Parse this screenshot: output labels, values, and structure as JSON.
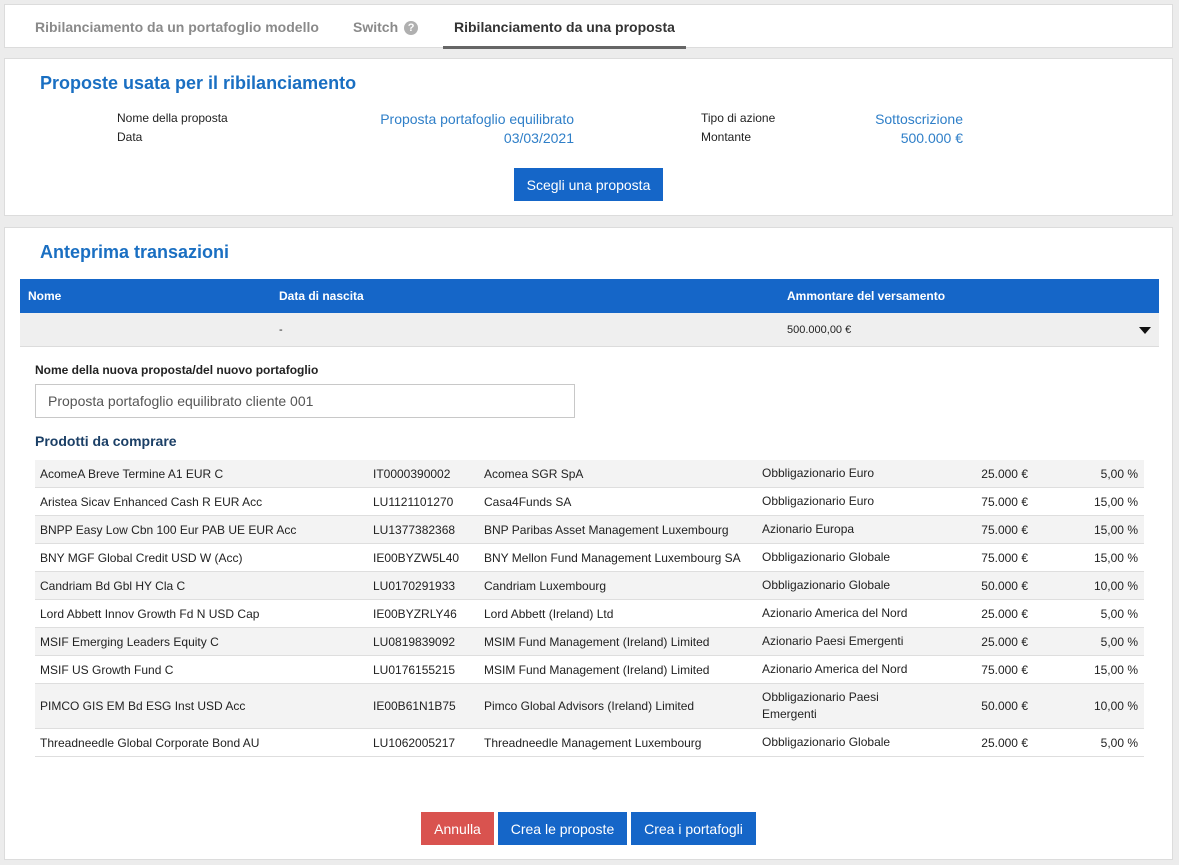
{
  "tabs": [
    {
      "label": "Ribilanciamento da un portafoglio modello"
    },
    {
      "label": "Switch"
    },
    {
      "label": "Ribilanciamento da una proposta"
    }
  ],
  "proposal": {
    "title": "Proposte usata per il ribilanciamento",
    "name_label": "Nome della proposta",
    "name_value": "Proposta portafoglio equilibrato",
    "date_label": "Data",
    "date_value": "03/03/2021",
    "action_label": "Tipo di azione",
    "action_value": "Sottoscrizione",
    "amount_label": "Montante",
    "amount_value": "500.000 €",
    "choose_button": "Scegli una proposta"
  },
  "preview": {
    "title": "Anteprima transazioni",
    "columns": {
      "name": "Nome",
      "birth": "Data di nascita",
      "amount": "Ammontare del versamento"
    },
    "row": {
      "name": "",
      "birth": "-",
      "amount": "500.000,00 €"
    },
    "new_name_label": "Nome della nuova proposta/del nuovo portafoglio",
    "new_name_value": "Proposta portafoglio equilibrato cliente 001",
    "products_title": "Prodotti da comprare",
    "products": [
      {
        "name": "AcomeA Breve Termine A1 EUR C",
        "isin": "IT0000390002",
        "manager": "Acomea SGR SpA",
        "category": "Obbligazionario Euro",
        "amount": "25.000 €",
        "weight": "5,00 %"
      },
      {
        "name": "Aristea Sicav Enhanced Cash R EUR Acc",
        "isin": "LU1121101270",
        "manager": "Casa4Funds SA",
        "category": "Obbligazionario Euro",
        "amount": "75.000 €",
        "weight": "15,00 %"
      },
      {
        "name": "BNPP Easy Low Cbn 100 Eur PAB UE EUR Acc",
        "isin": "LU1377382368",
        "manager": "BNP Paribas Asset Management Luxembourg",
        "category": "Azionario Europa",
        "amount": "75.000 €",
        "weight": "15,00 %"
      },
      {
        "name": "BNY MGF Global Credit USD W (Acc)",
        "isin": "IE00BYZW5L40",
        "manager": "BNY Mellon Fund Management Luxembourg SA",
        "category": "Obbligazionario Globale",
        "amount": "75.000 €",
        "weight": "15,00 %"
      },
      {
        "name": "Candriam Bd Gbl HY Cla C",
        "isin": "LU0170291933",
        "manager": "Candriam Luxembourg",
        "category": "Obbligazionario Globale",
        "amount": "50.000 €",
        "weight": "10,00 %"
      },
      {
        "name": "Lord Abbett Innov Growth Fd N USD Cap",
        "isin": "IE00BYZRLY46",
        "manager": "Lord Abbett (Ireland) Ltd",
        "category": "Azionario America del Nord",
        "amount": "25.000 €",
        "weight": "5,00 %"
      },
      {
        "name": "MSIF Emerging Leaders Equity C",
        "isin": "LU0819839092",
        "manager": "MSIM Fund Management (Ireland) Limited",
        "category": "Azionario Paesi Emergenti",
        "amount": "25.000 €",
        "weight": "5,00 %"
      },
      {
        "name": "MSIF US Growth Fund C",
        "isin": "LU0176155215",
        "manager": "MSIM Fund Management (Ireland) Limited",
        "category": "Azionario America del Nord",
        "amount": "75.000 €",
        "weight": "15,00 %"
      },
      {
        "name": "PIMCO GIS EM Bd ESG Inst USD Acc",
        "isin": "IE00B61N1B75",
        "manager": "Pimco Global Advisors (Ireland) Limited",
        "category": "Obbligazionario Paesi Emergenti",
        "amount": "50.000 €",
        "weight": "10,00 %"
      },
      {
        "name": "Threadneedle Global Corporate Bond AU",
        "isin": "LU1062005217",
        "manager": "Threadneedle Management Luxembourg",
        "category": "Obbligazionario Globale",
        "amount": "25.000 €",
        "weight": "5,00 %"
      }
    ],
    "buttons": {
      "cancel": "Annulla",
      "create_proposals": "Crea le proposte",
      "create_portfolios": "Crea i portafogli"
    }
  }
}
